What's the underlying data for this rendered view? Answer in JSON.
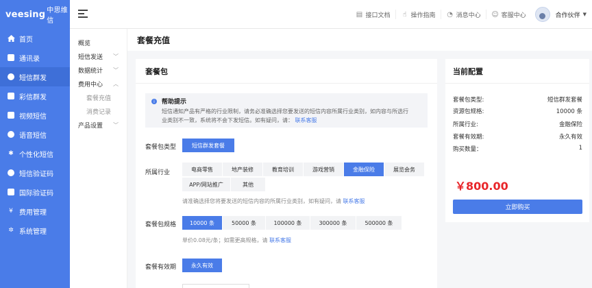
{
  "brand": {
    "logo": "veesing",
    "logo_cn": "中思维信"
  },
  "sidebar": {
    "items": [
      {
        "label": "首页",
        "icon": "home-icon"
      },
      {
        "label": "通讯录",
        "icon": "contacts-icon"
      },
      {
        "label": "短信群发",
        "icon": "chat-icon",
        "active": true
      },
      {
        "label": "彩信群发",
        "icon": "mms-icon"
      },
      {
        "label": "视频短信",
        "icon": "video-icon"
      },
      {
        "label": "语音短信",
        "icon": "voice-icon"
      },
      {
        "label": "个性化短信",
        "icon": "gear-icon"
      },
      {
        "label": "短信验证码",
        "icon": "chat-icon"
      },
      {
        "label": "国际验证码",
        "icon": "globe-icon"
      },
      {
        "label": "费用管理",
        "icon": "yen-icon"
      },
      {
        "label": "系统管理",
        "icon": "settings-icon"
      }
    ]
  },
  "header": {
    "links": [
      {
        "label": "接口文档",
        "icon": "document-icon"
      },
      {
        "label": "操作指南",
        "icon": "hand-icon"
      },
      {
        "label": "消息中心",
        "icon": "bell-icon"
      },
      {
        "label": "客服中心",
        "icon": "user-icon"
      }
    ],
    "user_name": "合作伙伴"
  },
  "subnav": {
    "overview": "概览",
    "sms_send": "短信发送",
    "data_stats": "数据统计",
    "fee_center": "费用中心",
    "recharge": "套餐充值",
    "consumption": "消费记录",
    "product_settings": "产品设置"
  },
  "page": {
    "title": "套餐充值"
  },
  "package": {
    "title": "套餐包",
    "help_title": "帮助提示",
    "help_text_1": "短信通知产品有严格的行业限制，请务必准确选择您要发送的短信内容所属行业类别，如内容与所选行",
    "help_text_2": "业类别不一致，系统将不会下发短信。如有疑问，请：",
    "help_link": "联系客服",
    "type_label": "套餐包类型",
    "type_selected": "短信群发套餐",
    "industry_label": "所属行业",
    "industries": [
      "电商零售",
      "地产装修",
      "教育培训",
      "游戏营销",
      "金融保险",
      "展览会务",
      "APP/网站推广",
      "其他"
    ],
    "industry_selected_index": 4,
    "industry_note": "请准确选择您将要发送的短信内容的所属行业类别，如有疑问，请",
    "industry_note_link": "联系客服",
    "spec_label": "套餐包规格",
    "specs": [
      "10000 条",
      "50000 条",
      "100000 条",
      "300000 条",
      "500000 条"
    ],
    "spec_selected_index": 0,
    "spec_note": "单价0.08元/条；如需更高规格，请",
    "spec_note_link": "联系客服",
    "validity_label": "套餐有效期",
    "validity_selected": "永久有效"
  },
  "config": {
    "title": "当前配置",
    "rows": [
      {
        "label": "套餐包类型:",
        "value": "短信群发套餐"
      },
      {
        "label": "资源包规格:",
        "value": "10000 条"
      },
      {
        "label": "所属行业:",
        "value": "金融保险"
      },
      {
        "label": "套餐有效期:",
        "value": "永久有效"
      },
      {
        "label": "购买数量：",
        "value": "1"
      }
    ],
    "price": "￥800.00",
    "buy_label": "立即购买"
  },
  "colors": {
    "primary": "#4a7ce8",
    "price": "#e8262a"
  }
}
